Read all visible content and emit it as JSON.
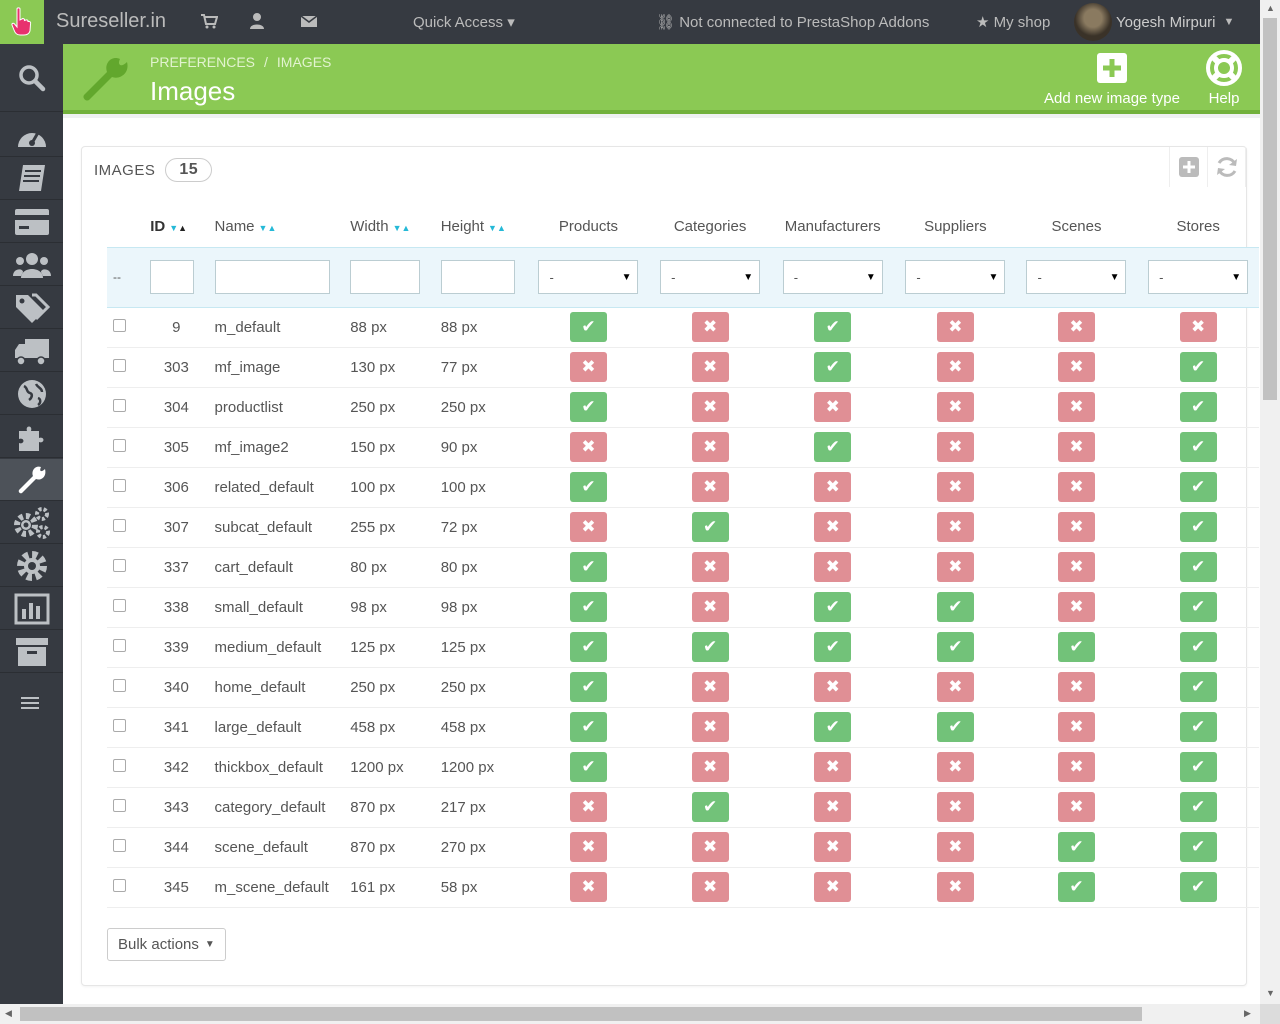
{
  "topbar": {
    "brand": "Sureseller.in",
    "quick_access": "Quick Access",
    "addons_status": "Not connected to PrestaShop Addons",
    "my_shop": "My shop",
    "user_name": "Yogesh Mirpuri"
  },
  "header": {
    "breadcrumb_parent": "PREFERENCES",
    "breadcrumb_sep": "/",
    "breadcrumb_current": "IMAGES",
    "title": "Images",
    "add_label": "Add new image type",
    "help_label": "Help"
  },
  "panel": {
    "title": "IMAGES",
    "count": "15"
  },
  "table": {
    "columns": {
      "id": "ID",
      "name": "Name",
      "width": "Width",
      "height": "Height",
      "products": "Products",
      "categories": "Categories",
      "manufacturers": "Manufacturers",
      "suppliers": "Suppliers",
      "scenes": "Scenes",
      "stores": "Stores"
    },
    "filter_reset": "--",
    "filter_select": "-",
    "rows": [
      {
        "id": "9",
        "name": "m_default",
        "width": "88 px",
        "height": "88 px",
        "flags": [
          1,
          0,
          1,
          0,
          0,
          0
        ]
      },
      {
        "id": "303",
        "name": "mf_image",
        "width": "130 px",
        "height": "77 px",
        "flags": [
          0,
          0,
          1,
          0,
          0,
          1
        ]
      },
      {
        "id": "304",
        "name": "productlist",
        "width": "250 px",
        "height": "250 px",
        "flags": [
          1,
          0,
          0,
          0,
          0,
          1
        ]
      },
      {
        "id": "305",
        "name": "mf_image2",
        "width": "150 px",
        "height": "90 px",
        "flags": [
          0,
          0,
          1,
          0,
          0,
          1
        ]
      },
      {
        "id": "306",
        "name": "related_default",
        "width": "100 px",
        "height": "100 px",
        "flags": [
          1,
          0,
          0,
          0,
          0,
          1
        ]
      },
      {
        "id": "307",
        "name": "subcat_default",
        "width": "255 px",
        "height": "72 px",
        "flags": [
          0,
          1,
          0,
          0,
          0,
          1
        ]
      },
      {
        "id": "337",
        "name": "cart_default",
        "width": "80 px",
        "height": "80 px",
        "flags": [
          1,
          0,
          0,
          0,
          0,
          1
        ]
      },
      {
        "id": "338",
        "name": "small_default",
        "width": "98 px",
        "height": "98 px",
        "flags": [
          1,
          0,
          1,
          1,
          0,
          1
        ]
      },
      {
        "id": "339",
        "name": "medium_default",
        "width": "125 px",
        "height": "125 px",
        "flags": [
          1,
          1,
          1,
          1,
          1,
          1
        ]
      },
      {
        "id": "340",
        "name": "home_default",
        "width": "250 px",
        "height": "250 px",
        "flags": [
          1,
          0,
          0,
          0,
          0,
          1
        ]
      },
      {
        "id": "341",
        "name": "large_default",
        "width": "458 px",
        "height": "458 px",
        "flags": [
          1,
          0,
          1,
          1,
          0,
          1
        ]
      },
      {
        "id": "342",
        "name": "thickbox_default",
        "width": "1200 px",
        "height": "1200 px",
        "flags": [
          1,
          0,
          0,
          0,
          0,
          1
        ]
      },
      {
        "id": "343",
        "name": "category_default",
        "width": "870 px",
        "height": "217 px",
        "flags": [
          0,
          1,
          0,
          0,
          0,
          1
        ]
      },
      {
        "id": "344",
        "name": "scene_default",
        "width": "870 px",
        "height": "270 px",
        "flags": [
          0,
          0,
          0,
          0,
          1,
          1
        ]
      },
      {
        "id": "345",
        "name": "m_scene_default",
        "width": "161 px",
        "height": "58 px",
        "flags": [
          0,
          0,
          0,
          0,
          1,
          1
        ]
      }
    ]
  },
  "bulk_actions": "Bulk actions",
  "colors": {
    "accent": "#8bc954",
    "dark": "#363a41",
    "yes": "#72c279",
    "no": "#e08f95"
  },
  "icons": {
    "sidebar": [
      "search-icon",
      "dashboard-icon",
      "orders-icon",
      "catalog-icon",
      "customers-icon",
      "price-rules-icon",
      "shipping-icon",
      "localization-icon",
      "modules-icon",
      "preferences-icon",
      "advanced-parameters-icon",
      "administration-icon",
      "stats-icon",
      "stock-icon",
      "menu-collapse-icon"
    ]
  }
}
